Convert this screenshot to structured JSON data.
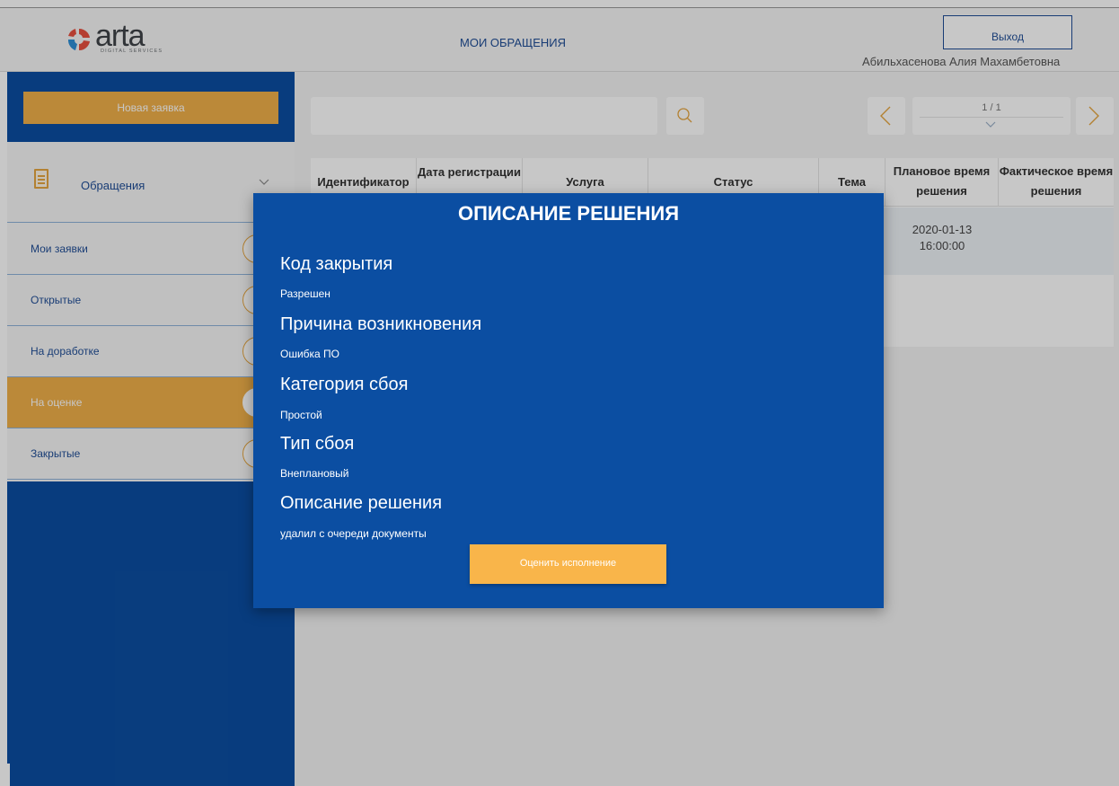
{
  "header": {
    "logo_text": "arta",
    "logo_subtext": "DIGITAL SERVICES",
    "title": "МОИ ОБРАЩЕНИЯ",
    "logout_label": "Выход",
    "user_name": "Абильхасенова Алия Махамбетовна"
  },
  "sidebar": {
    "new_request_label": "Новая заявка",
    "section_label": "Обращения",
    "items": [
      {
        "label": "Мои заявки"
      },
      {
        "label": "Открытые"
      },
      {
        "label": "На доработке"
      },
      {
        "label": "На оценке",
        "active": true
      },
      {
        "label": "Закрытые"
      }
    ]
  },
  "search": {
    "placeholder": ""
  },
  "pagination": {
    "text": "1 / 1"
  },
  "table": {
    "columns": [
      "Идентификатор",
      "Дата регистрации",
      "Услуга",
      "Статус",
      "Тема",
      "Плановое время решения",
      "Фактическое время решения"
    ],
    "rows": [
      {
        "planned_date": "2020-01-13",
        "planned_time": "16:00:00"
      }
    ]
  },
  "modal": {
    "title": "ОПИСАНИЕ РЕШЕНИЯ",
    "fields": [
      {
        "label": "Код закрытия",
        "value": "Разрешен"
      },
      {
        "label": "Причина возникновения",
        "value": "Ошибка ПО"
      },
      {
        "label": "Категория сбоя",
        "value": "Простой"
      },
      {
        "label": "Тип сбоя",
        "value": "Внеплановый"
      },
      {
        "label": "Описание решения",
        "value": "удалил с очереди документы"
      }
    ],
    "rate_label": "Оценить исполнение"
  },
  "colors": {
    "brand_blue": "#0b4ea2",
    "accent_orange": "#f0b04a"
  }
}
